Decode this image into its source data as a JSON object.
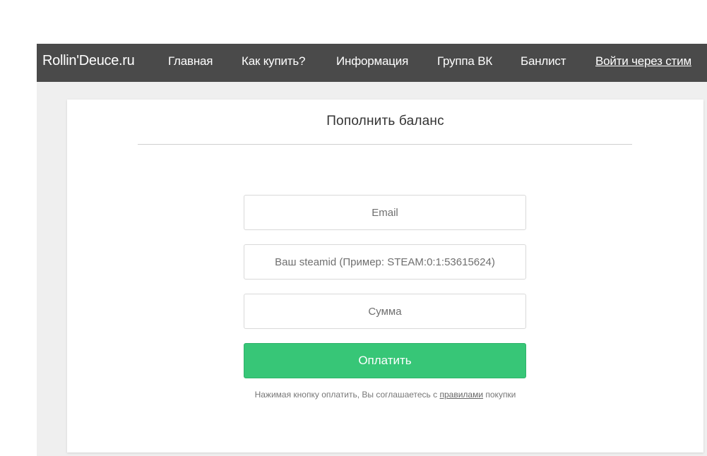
{
  "header": {
    "brand": "Rollin'Deuce.ru",
    "nav": [
      {
        "label": "Главная"
      },
      {
        "label": "Как купить?"
      },
      {
        "label": "Информация"
      },
      {
        "label": "Группа ВК"
      },
      {
        "label": "Банлист"
      }
    ],
    "login_label": "Войти через стим"
  },
  "form": {
    "title": "Пополнить баланс",
    "email_placeholder": "Email",
    "steamid_placeholder": "Ваш steamid (Пример: STEAM:0:1:53615624)",
    "amount_placeholder": "Сумма",
    "submit_label": "Оплатить",
    "terms_prefix": "Нажимая кнопку оплатить, Вы соглашаетесь с ",
    "terms_link": "правилами",
    "terms_suffix": " покупки"
  },
  "colors": {
    "navbar": "#4a4a4a",
    "page_background": "#efefef",
    "submit_button": "#37c677"
  }
}
